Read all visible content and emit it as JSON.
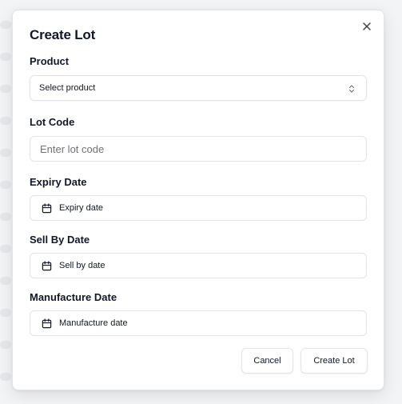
{
  "dialog": {
    "title": "Create Lot",
    "close_icon": "x-icon"
  },
  "fields": {
    "product": {
      "label": "Product",
      "value": "Select product",
      "icon": "chevrons-up-down-icon"
    },
    "lot_code": {
      "label": "Lot Code",
      "placeholder": "Enter lot code"
    },
    "expiry_date": {
      "label": "Expiry Date",
      "placeholder": "Expiry date",
      "icon": "calendar-icon"
    },
    "sell_by_date": {
      "label": "Sell By Date",
      "placeholder": "Sell by date",
      "icon": "calendar-icon"
    },
    "manufacture_date": {
      "label": "Manufacture Date",
      "placeholder": "Manufacture date",
      "icon": "calendar-icon"
    }
  },
  "actions": {
    "cancel_label": "Cancel",
    "submit_label": "Create Lot"
  }
}
